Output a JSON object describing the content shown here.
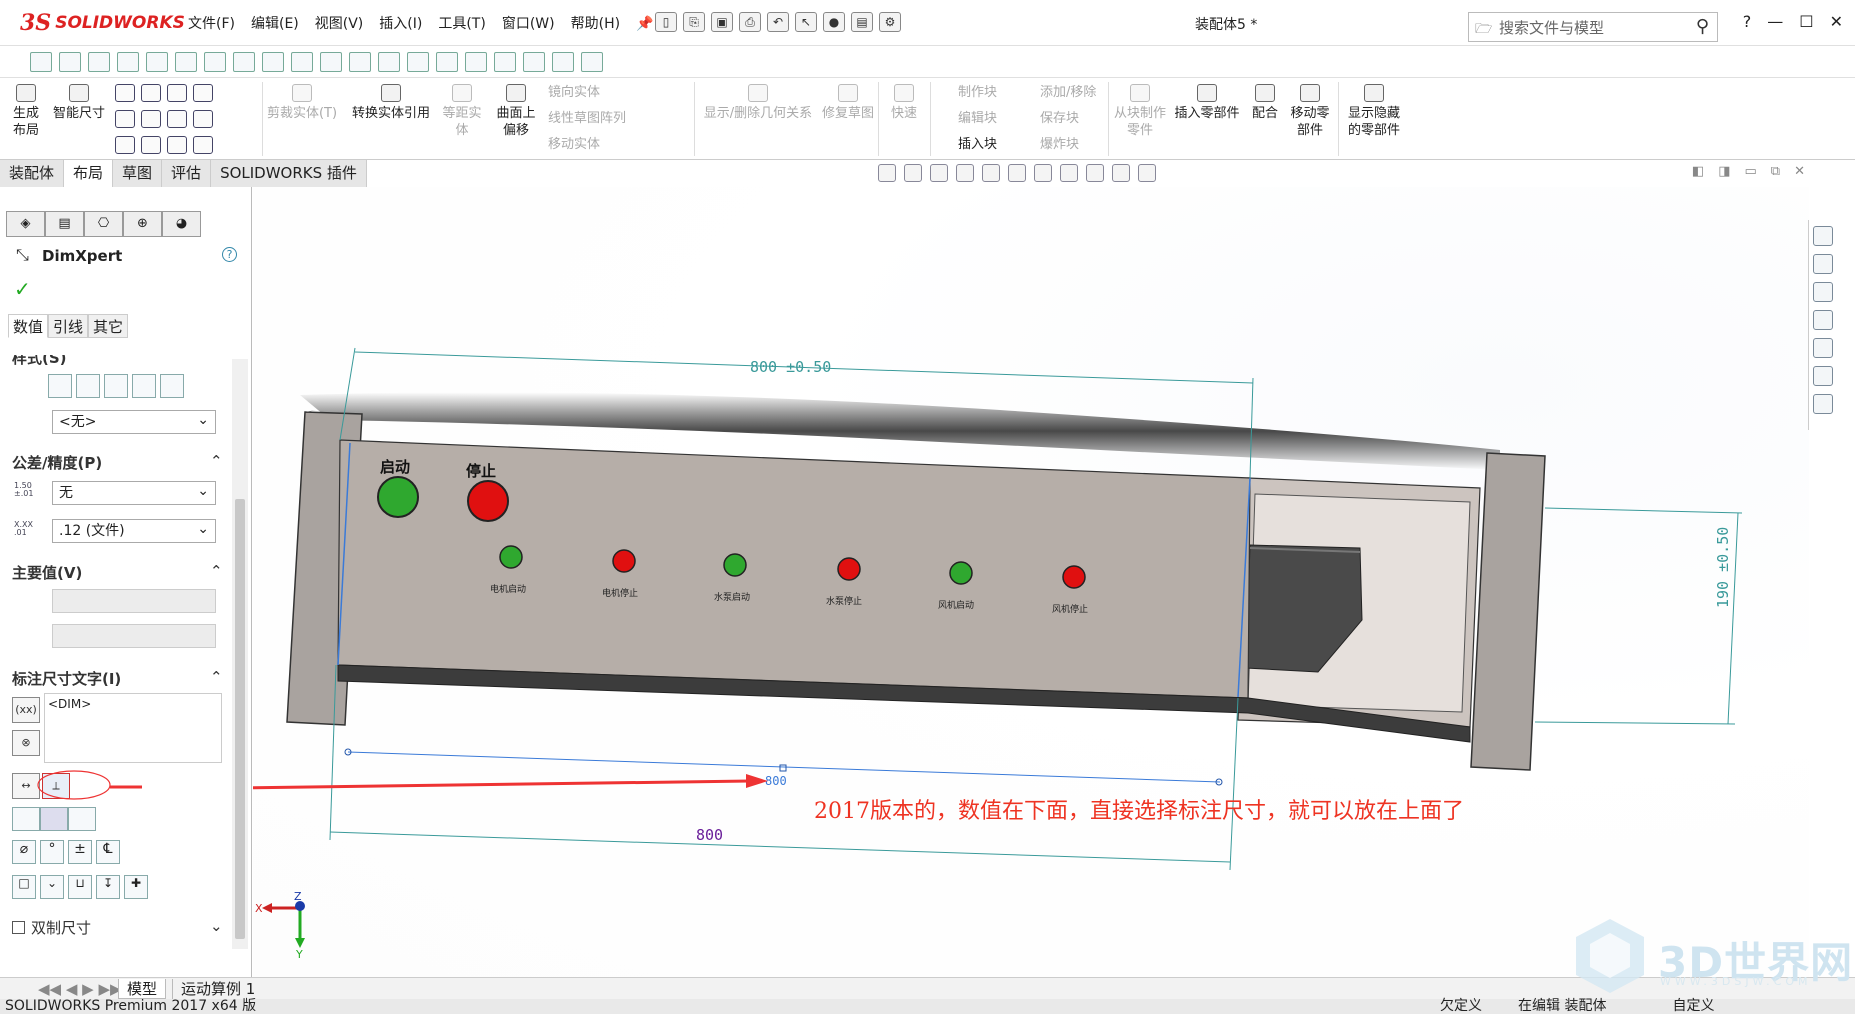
{
  "app": {
    "logo_ds": "3S",
    "logo_text": "SOLIDWORKS",
    "doc_title": "装配体5 *",
    "search_placeholder": "搜索文件与模型"
  },
  "menu": [
    "文件(F)",
    "编辑(E)",
    "视图(V)",
    "插入(I)",
    "工具(T)",
    "窗口(W)",
    "帮助(H)"
  ],
  "ribbon": {
    "items": [
      {
        "label": "生成布局",
        "disabled": false
      },
      {
        "label": "智能尺寸",
        "disabled": false
      },
      {
        "label": "剪裁实体(T)",
        "disabled": true
      },
      {
        "label": "转换实体引用",
        "disabled": false
      },
      {
        "label": "等距实体",
        "disabled": true
      },
      {
        "label": "曲面上偏移",
        "disabled": false
      },
      {
        "label": "镜向实体",
        "disabled": true
      },
      {
        "label": "线性草图阵列",
        "disabled": true
      },
      {
        "label": "移动实体",
        "disabled": true
      },
      {
        "label": "显示/删除几何关系",
        "disabled": true
      },
      {
        "label": "修复草图",
        "disabled": true
      },
      {
        "label": "快速",
        "disabled": true
      },
      {
        "label": "制作块",
        "disabled": true
      },
      {
        "label": "编辑块",
        "disabled": true
      },
      {
        "label": "插入块",
        "disabled": false
      },
      {
        "label": "添加/移除",
        "disabled": true
      },
      {
        "label": "保存块",
        "disabled": true
      },
      {
        "label": "爆炸块",
        "disabled": true
      },
      {
        "label": "从块制作零件",
        "disabled": true
      },
      {
        "label": "插入零部件",
        "disabled": false
      },
      {
        "label": "配合",
        "disabled": false
      },
      {
        "label": "移动零部件",
        "disabled": false
      },
      {
        "label": "显示隐藏的零部件",
        "disabled": false
      }
    ]
  },
  "tabs": [
    "装配体",
    "布局",
    "草图",
    "评估",
    "SOLIDWORKS 插件"
  ],
  "active_tab": 1,
  "panel": {
    "title": "DimXpert",
    "help": "?",
    "subtabs": [
      "数值",
      "引线",
      "其它"
    ],
    "style_section": "样式(S)",
    "style_select": "<无>",
    "tolerance_section": "公差/精度(P)",
    "tolerance_select": "无",
    "precision_select": ".12 (文件)",
    "primary_section": "主要值(V)",
    "dimtext_section": "标注尺寸文字(I)",
    "dimtext_value": "<DIM>",
    "dual_dim": "双制尺寸",
    "tol_icon_text": "1.50 ±.01",
    "prec_icon_text": "X.XX .01"
  },
  "bottom_tabs": [
    "模型",
    "运动算例 1"
  ],
  "status": {
    "left": "SOLIDWORKS Premium 2017 x64 版",
    "custom": "欠定义",
    "editing": "在编辑 装配体",
    "units": "自定义"
  },
  "model": {
    "panel_color": "#b8b0aa",
    "button_green": "#2fa82f",
    "button_red": "#e01010",
    "label_start": "启动",
    "label_stop": "停止",
    "small_labels": [
      "电机启动",
      "电机停止",
      "水泵启动",
      "水泵停止",
      "风机启动",
      "风机停止"
    ],
    "dim_top": "800 ±0.50",
    "dim_right": "190 ±0.50",
    "dim_bottom": "800",
    "dim_drag": "800"
  },
  "annotation": "2017版本的，数值在下面，直接选择标注尺寸，就可以放在上面了",
  "watermark": {
    "text": "3D世界网",
    "sub": "WWW.3DSJW.COM"
  },
  "axes": {
    "x": "X",
    "y": "Y",
    "z": "Z"
  }
}
